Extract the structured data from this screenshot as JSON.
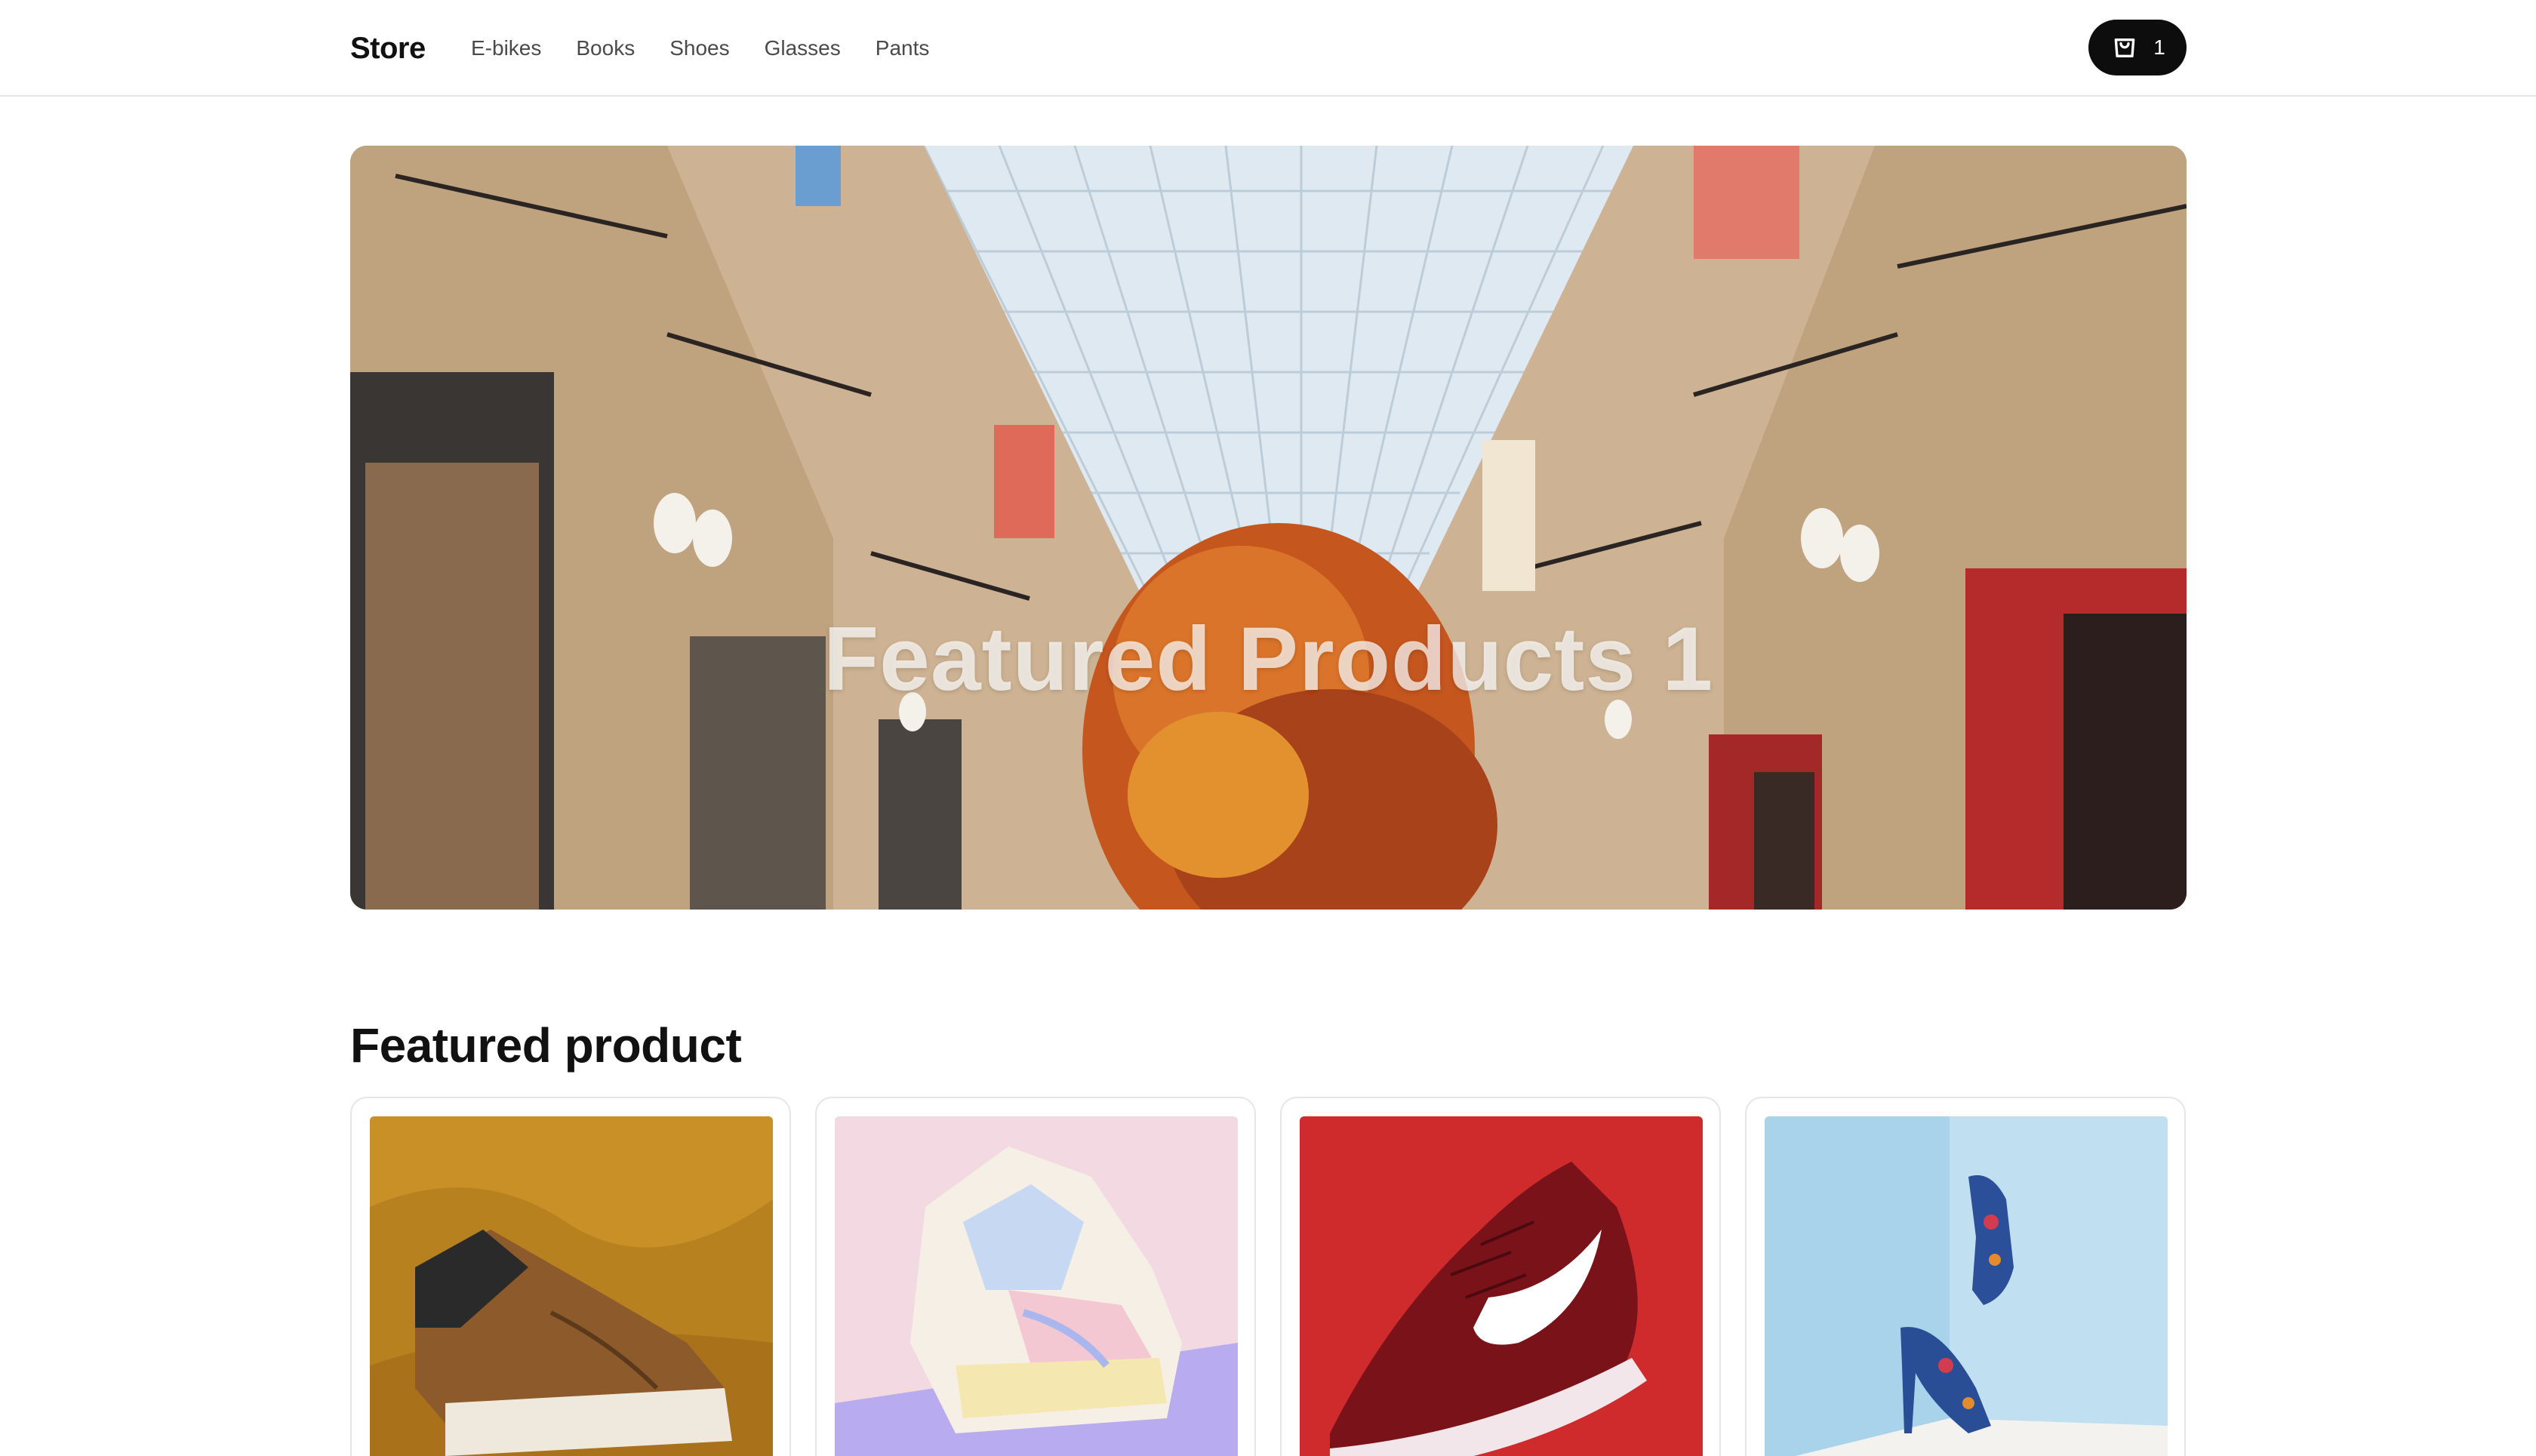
{
  "header": {
    "brand": "Store",
    "nav": [
      {
        "label": "E-bikes"
      },
      {
        "label": "Books"
      },
      {
        "label": "Shoes"
      },
      {
        "label": "Glasses"
      },
      {
        "label": "Pants"
      }
    ],
    "cart": {
      "count": "1",
      "icon": "shopping-bag-icon"
    }
  },
  "hero": {
    "title": "Featured Products 1"
  },
  "featured": {
    "title": "Featured product",
    "products": [
      {
        "image": "brown-sneaker-image"
      },
      {
        "image": "pastel-sneaker-image"
      },
      {
        "image": "red-running-shoe-image"
      },
      {
        "image": "floral-heels-image"
      }
    ]
  },
  "colors": {
    "text": "#111111",
    "nav_text": "#4a4a4a",
    "cart_bg": "#0d0d0d",
    "border": "#e6e6e6"
  }
}
